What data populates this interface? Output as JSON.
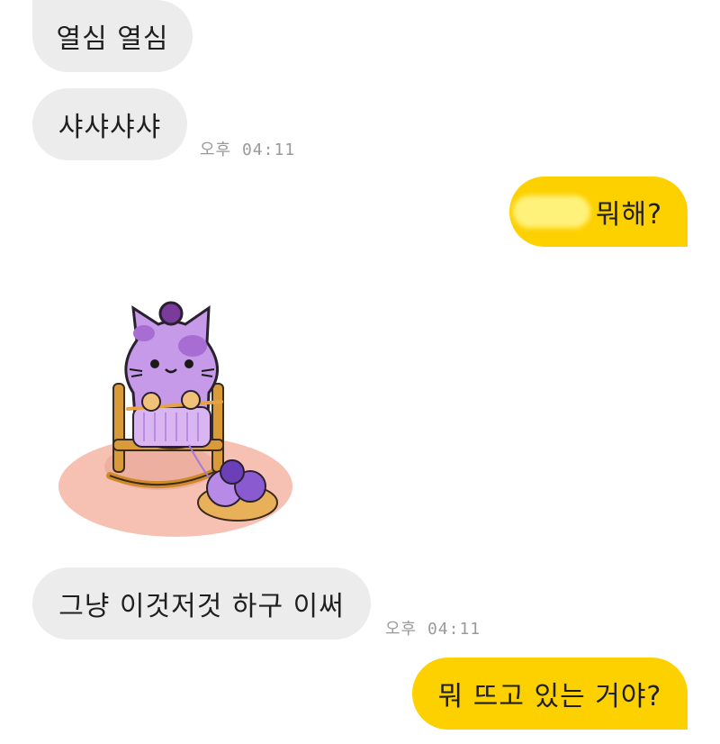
{
  "messages": [
    {
      "text": "열심 열심",
      "side": "received"
    },
    {
      "text": "샤샤샤샤",
      "side": "received",
      "time": "오후 04:11"
    },
    {
      "text": "뭐해?",
      "side": "sent"
    },
    {
      "sticker": "knitting-cat-sticker",
      "side": "received"
    },
    {
      "text": "그냥 이것저것 하구 이써",
      "side": "received",
      "time": "오후 04:11"
    },
    {
      "text": "뭐 뜨고 있는 거야?",
      "side": "sent"
    }
  ],
  "colors": {
    "received_bubble": "#ececec",
    "sent_bubble": "#fdd000",
    "timestamp": "#9a9a9a"
  }
}
